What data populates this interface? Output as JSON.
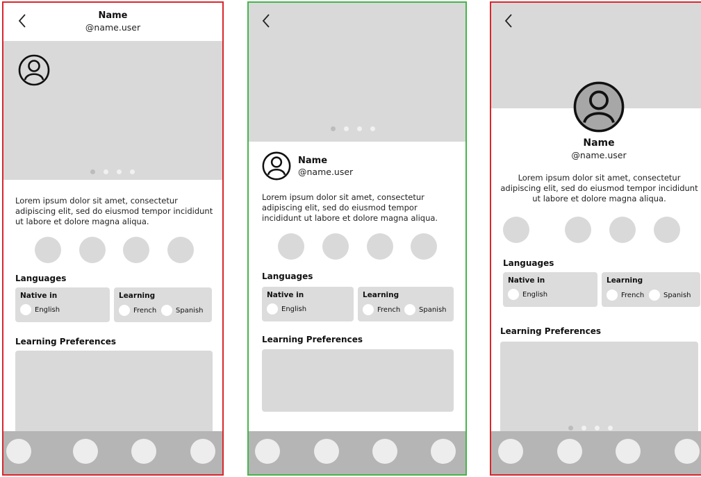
{
  "profile": {
    "name": "Name",
    "handle": "@name.user",
    "bio": "Lorem ipsum dolor sit amet, consectetur adipiscing elit, sed do eiusmod tempor incididunt ut labore et dolore magna aliqua."
  },
  "languages": {
    "heading": "Languages",
    "native_label": "Native in",
    "native": [
      "English"
    ],
    "learning_label": "Learning",
    "learning": [
      "French",
      "Spanish"
    ]
  },
  "preferences": {
    "heading": "Learning Preferences"
  },
  "colors": {
    "frame1_border": "#d9262c",
    "frame2_border": "#43b649",
    "frame3_border": "#d9262c",
    "placeholder": "#d9d9d9",
    "nav_bar": "#b5b5b5"
  },
  "icons": [
    "chevron-left-icon",
    "user-avatar-icon"
  ],
  "carousel": {
    "dot_count": 4,
    "active_index": 0
  }
}
